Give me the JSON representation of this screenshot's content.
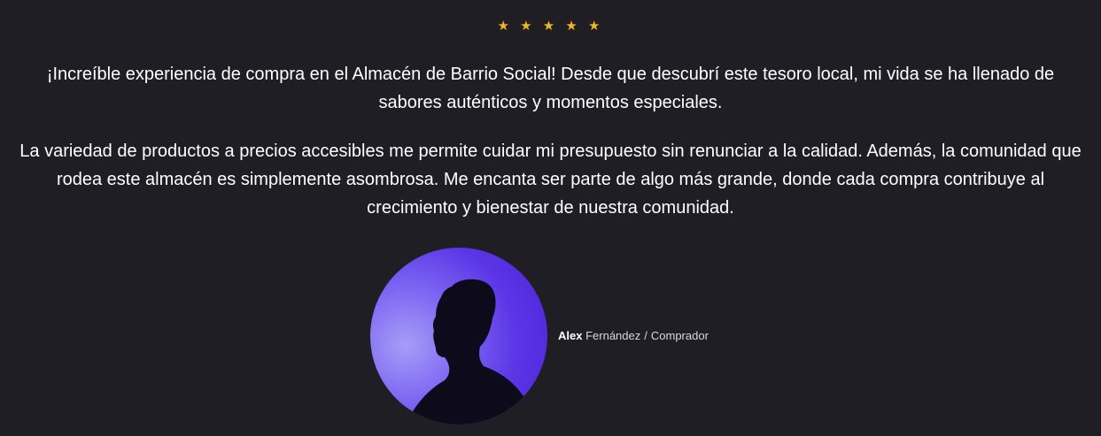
{
  "rating": {
    "stars": 5,
    "glyph": "★",
    "color": "#f2b61c"
  },
  "quote": {
    "paragraph_1": "¡Increíble experiencia de compra en el Almacén de Barrio Social! Desde que descubrí este tesoro local, mi vida se ha llenado de sabores auténticos y momentos especiales.",
    "paragraph_2": "La variedad de productos a precios accesibles me permite cuidar mi presupuesto sin renunciar a la calidad. Además, la comunidad que rodea este almacén es simplemente asombrosa. Me encanta ser parte de algo más grande, donde cada compra contribuye al crecimiento y bienestar de nuestra comunidad."
  },
  "author": {
    "first_name": "Alex",
    "last_name": "Fernández",
    "separator": "/",
    "role": "Comprador"
  },
  "colors": {
    "background": "#1f1e24",
    "avatar_accent": "#5b35e6"
  }
}
